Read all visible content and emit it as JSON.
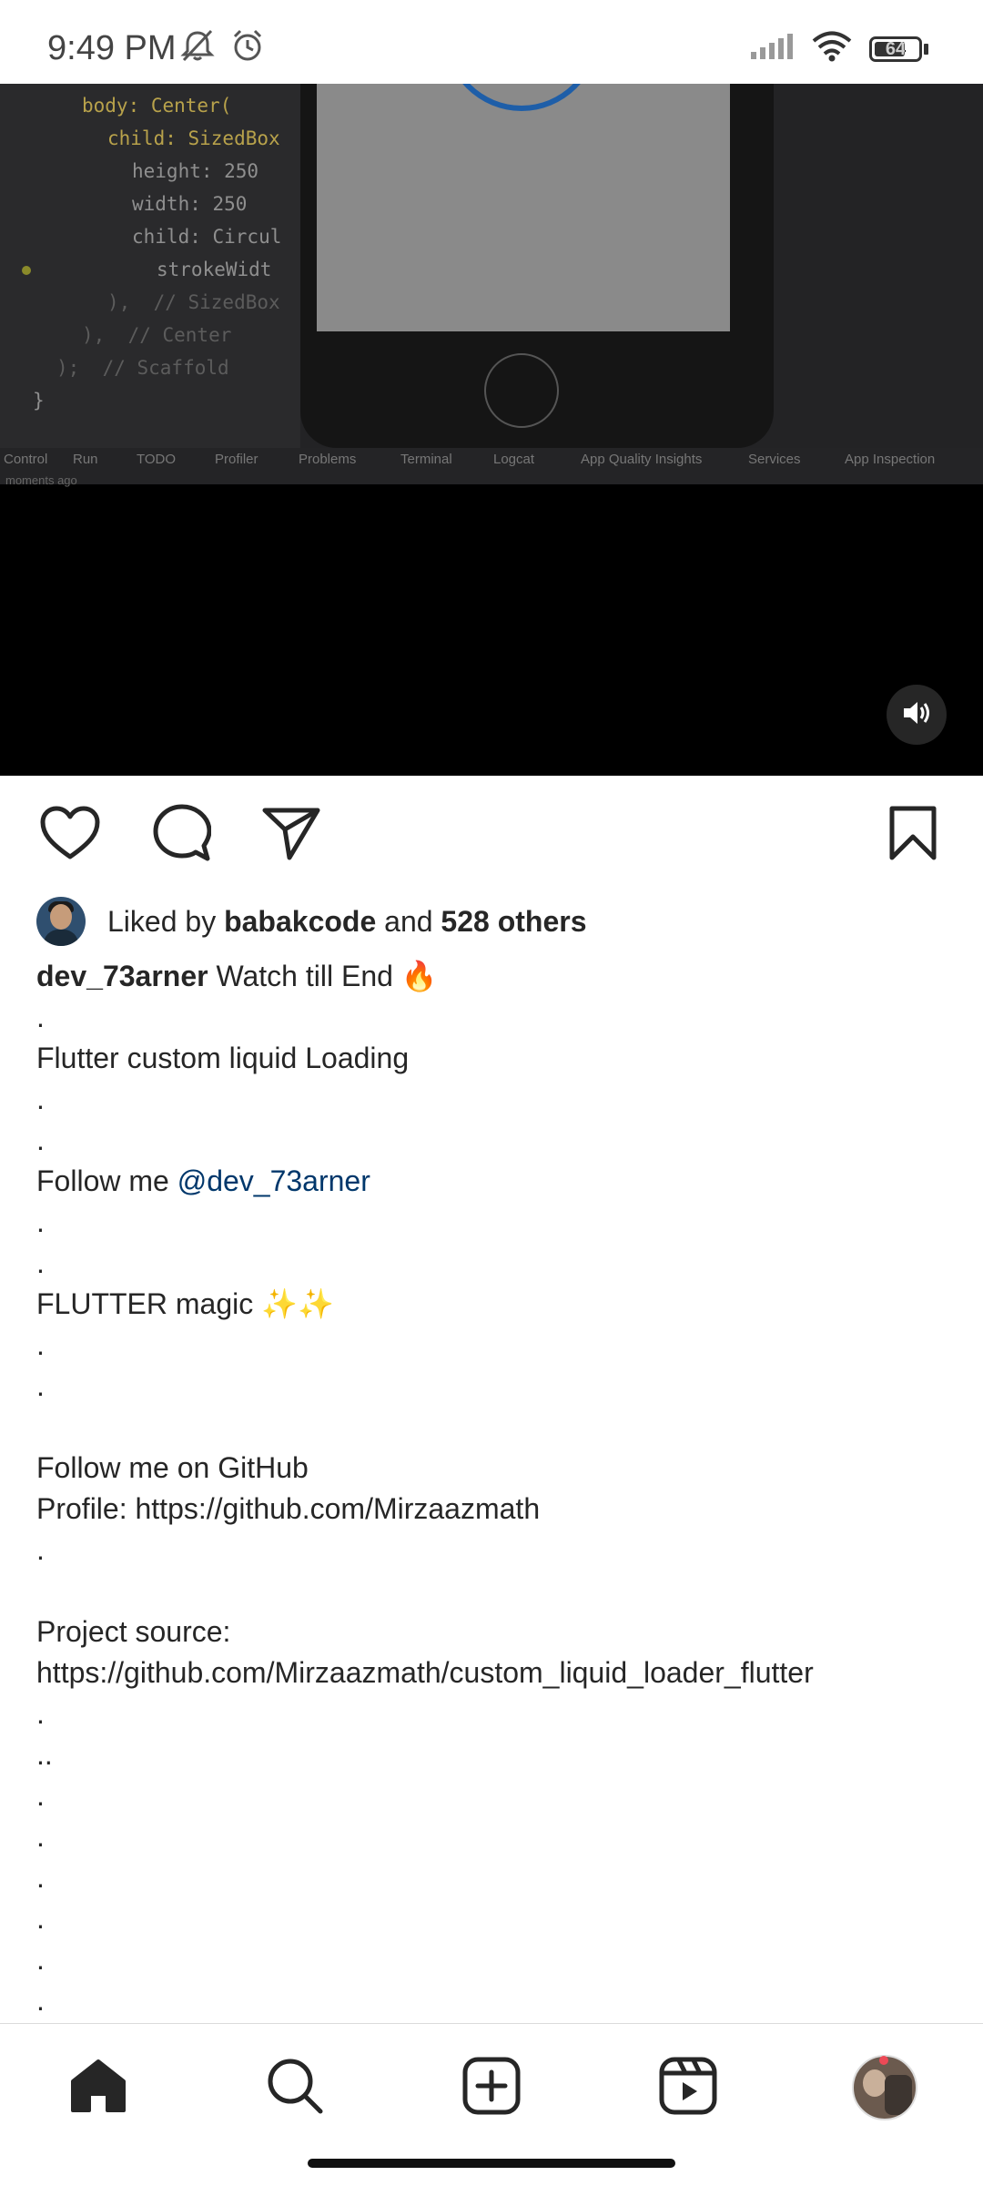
{
  "status_bar": {
    "time": "9:49 PM",
    "battery": "64",
    "icons": [
      "mute-bell-icon",
      "alarm-icon",
      "signal-icon",
      "wifi-icon",
      "battery-icon"
    ]
  },
  "video": {
    "code_lines": [
      "body: Center(",
      "child: SizedBox",
      "height: 250",
      "width: 250",
      "child: Circul",
      "strokeWidt",
      "),  // SizedBox",
      "),  // Center",
      ");  // Scaffold",
      "}"
    ],
    "ide_tabs": [
      "Control",
      "Run",
      "TODO",
      "Profiler",
      "Problems",
      "Terminal",
      "Logcat",
      "App Quality Insights",
      "Services",
      "App Inspection"
    ],
    "ide_status": "moments ago",
    "mute_icon": "speaker-volume-icon"
  },
  "actions": {
    "icons": [
      "heart-icon",
      "comment-icon",
      "share-icon",
      "bookmark-icon"
    ]
  },
  "likes": {
    "prefix": "Liked by ",
    "user": "babakcode",
    "middle": " and ",
    "count": "528 others"
  },
  "caption": {
    "username": "dev_73arner",
    "first_line_text": " Watch till End 🔥",
    "lines": [
      ".",
      "Flutter custom liquid Loading",
      ".",
      ".",
      "Follow me ",
      ".",
      ".",
      "FLUTTER magic ✨✨",
      ".",
      ".",
      "",
      "Follow me on GitHub",
      "Profile: https://github.com/Mirzaazmath",
      ".",
      "",
      "Project source:",
      "https://github.com/Mirzaazmath/custom_liquid_loader_flutter",
      ".",
      "..",
      ".",
      ".",
      ".",
      ".",
      ".",
      "."
    ],
    "mention": "@dev_73arner"
  },
  "bottom_nav": {
    "items": [
      "home-icon",
      "search-icon",
      "create-post-icon",
      "reels-icon",
      "profile-avatar"
    ]
  }
}
